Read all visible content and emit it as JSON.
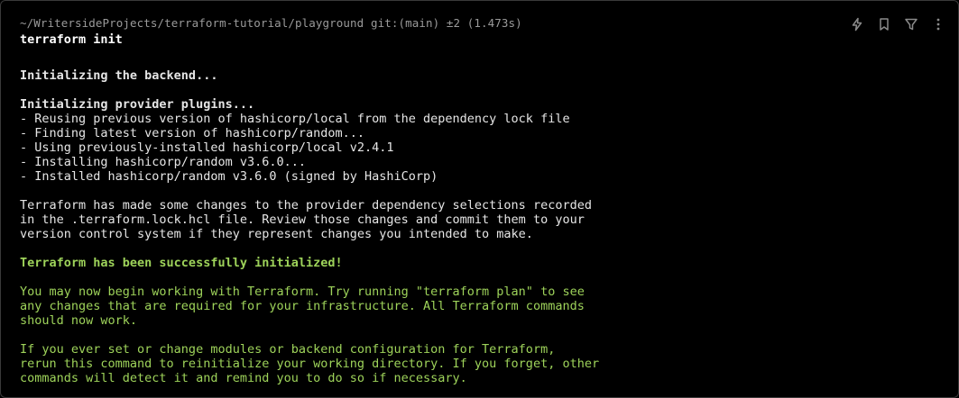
{
  "prompt": {
    "path": "~/WritersideProjects/terraform-tutorial/playground",
    "git": "git:(main) ±2",
    "duration": "(1.473s)"
  },
  "command": "terraform init",
  "output": [
    {
      "text": "Initializing the backend...",
      "style": "bold"
    },
    {
      "text": "",
      "style": "gap"
    },
    {
      "text": "Initializing provider plugins...",
      "style": "bold"
    },
    {
      "text": "- Reusing previous version of hashicorp/local from the dependency lock file",
      "style": "normal"
    },
    {
      "text": "- Finding latest version of hashicorp/random...",
      "style": "normal"
    },
    {
      "text": "- Using previously-installed hashicorp/local v2.4.1",
      "style": "normal"
    },
    {
      "text": "- Installing hashicorp/random v3.6.0...",
      "style": "normal"
    },
    {
      "text": "- Installed hashicorp/random v3.6.0 (signed by HashiCorp)",
      "style": "normal"
    },
    {
      "text": "",
      "style": "gap"
    },
    {
      "text": "Terraform has made some changes to the provider dependency selections recorded",
      "style": "normal"
    },
    {
      "text": "in the .terraform.lock.hcl file. Review those changes and commit them to your",
      "style": "normal"
    },
    {
      "text": "version control system if they represent changes you intended to make.",
      "style": "normal"
    },
    {
      "text": "",
      "style": "gap"
    },
    {
      "text": "Terraform has been successfully initialized!",
      "style": "green-bold"
    },
    {
      "text": "",
      "style": "gap"
    },
    {
      "text": "You may now begin working with Terraform. Try running \"terraform plan\" to see",
      "style": "green"
    },
    {
      "text": "any changes that are required for your infrastructure. All Terraform commands",
      "style": "green"
    },
    {
      "text": "should now work.",
      "style": "green"
    },
    {
      "text": "",
      "style": "gap"
    },
    {
      "text": "If you ever set or change modules or backend configuration for Terraform,",
      "style": "green"
    },
    {
      "text": "rerun this command to reinitialize your working directory. If you forget, other",
      "style": "green"
    },
    {
      "text": "commands will detect it and remind you to do so if necessary.",
      "style": "green"
    }
  ],
  "toolbar": [
    {
      "name": "lightning-icon"
    },
    {
      "name": "bookmark-icon"
    },
    {
      "name": "filter-icon"
    },
    {
      "name": "more-vertical-icon"
    }
  ],
  "colors": {
    "background": "#000000",
    "text": "#e6e6e6",
    "success": "#9ed35a",
    "prompt": "#9a9a9a"
  }
}
